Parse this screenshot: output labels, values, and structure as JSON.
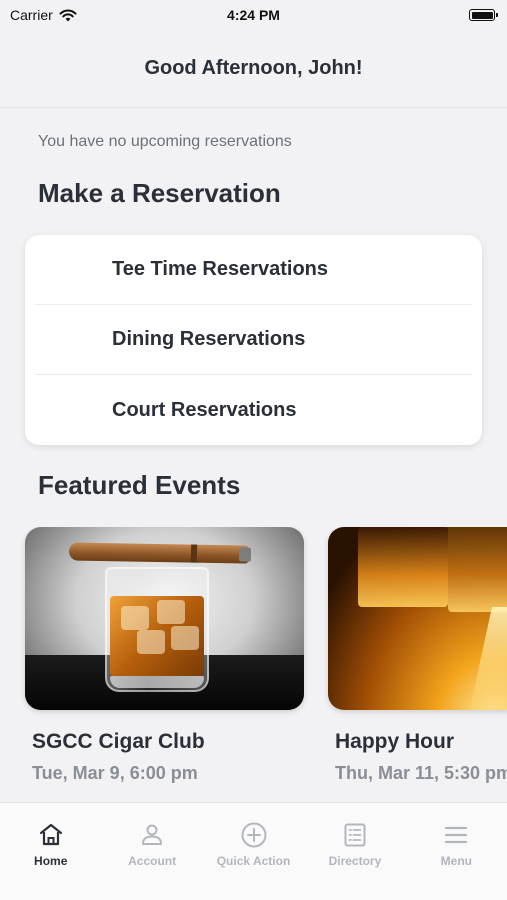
{
  "status_bar": {
    "carrier": "Carrier",
    "time": "4:24 PM",
    "battery_level": 1.0
  },
  "header": {
    "greeting": "Good Afternoon, John!"
  },
  "reservations": {
    "empty_message": "You have no upcoming reservations",
    "section_title": "Make a Reservation",
    "items": [
      {
        "label": "Tee Time Reservations"
      },
      {
        "label": "Dining Reservations"
      },
      {
        "label": "Court Reservations"
      }
    ]
  },
  "events": {
    "section_title": "Featured Events",
    "items": [
      {
        "name": "SGCC Cigar Club",
        "date": "Tue, Mar 9, 6:00 pm"
      },
      {
        "name": "Happy Hour",
        "date": "Thu, Mar 11, 5:30 pm"
      }
    ]
  },
  "tab_bar": {
    "tabs": [
      {
        "label": "Home",
        "icon": "home-icon",
        "active": true
      },
      {
        "label": "Account",
        "icon": "person-icon",
        "active": false
      },
      {
        "label": "Quick Action",
        "icon": "plus-circle-icon",
        "active": false
      },
      {
        "label": "Directory",
        "icon": "list-icon",
        "active": false
      },
      {
        "label": "Menu",
        "icon": "hamburger-icon",
        "active": false
      }
    ]
  },
  "colors": {
    "background": "#f2f2f4",
    "text_primary": "#2b2f38",
    "text_secondary": "#6d717a",
    "tab_inactive": "#b3b6bd"
  }
}
